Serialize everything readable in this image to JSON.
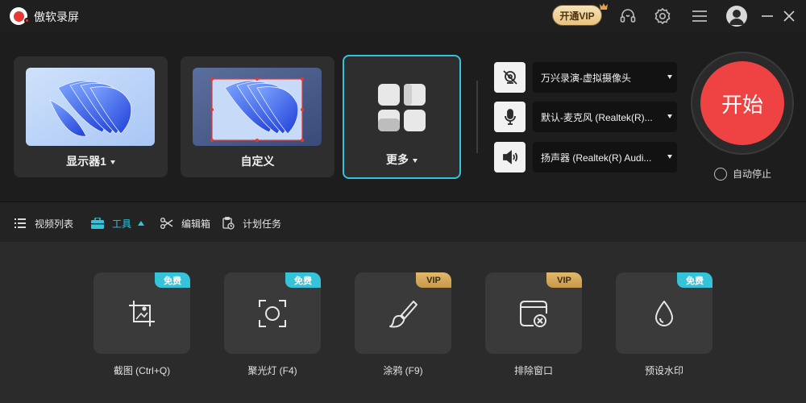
{
  "app": {
    "title": "傲软录屏"
  },
  "titlebar": {
    "vip_label": "开通VIP",
    "icons": [
      "headset-icon",
      "settings-gear-icon",
      "menu-icon",
      "avatar-icon",
      "minimize-icon",
      "close-icon"
    ]
  },
  "sources": [
    {
      "label": "显示器1",
      "has_dropdown": true,
      "icon": "monitor-thumbnail"
    },
    {
      "label": "自定义",
      "has_dropdown": false,
      "icon": "custom-region-thumbnail"
    },
    {
      "label": "更多",
      "has_dropdown": true,
      "icon": "more-grid-icon",
      "active": true
    }
  ],
  "devices": {
    "camera": {
      "icon": "camera-off-icon",
      "value": "万兴录演-虚拟摄像头"
    },
    "microphone": {
      "icon": "microphone-icon",
      "value": "默认-麦克风 (Realtek(R)..."
    },
    "speaker": {
      "icon": "speaker-icon",
      "value": "扬声器 (Realtek(R) Audi..."
    }
  },
  "start": {
    "label": "开始",
    "auto_stop_label": "自动停止"
  },
  "tabs": [
    {
      "label": "视频列表",
      "icon": "list-icon"
    },
    {
      "label": "工具",
      "icon": "toolbox-icon",
      "active": true
    },
    {
      "label": "编辑箱",
      "icon": "scissors-icon"
    },
    {
      "label": "计划任务",
      "icon": "schedule-task-icon"
    }
  ],
  "tools": [
    {
      "label": "截图 (Ctrl+Q)",
      "badge": "免费",
      "badge_type": "free",
      "icon": "crop-screenshot-icon"
    },
    {
      "label": "聚光灯 (F4)",
      "badge": "免费",
      "badge_type": "free",
      "icon": "spotlight-icon"
    },
    {
      "label": "涂鸦 (F9)",
      "badge": "VIP",
      "badge_type": "vip",
      "icon": "brush-icon"
    },
    {
      "label": "排除窗口",
      "badge": "VIP",
      "badge_type": "vip",
      "icon": "exclude-window-icon"
    },
    {
      "label": "预设水印",
      "badge": "免费",
      "badge_type": "free",
      "icon": "watermark-drop-icon"
    }
  ],
  "colors": {
    "accent": "#34c3d8",
    "start_red": "#ef4242",
    "vip_gold": "#e9c27d"
  }
}
